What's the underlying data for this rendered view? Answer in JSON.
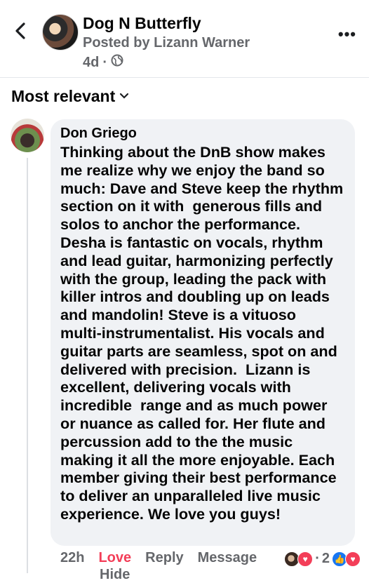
{
  "header": {
    "page_name": "Dog N Butterfly",
    "posted_by": "Posted by Lizann Warner",
    "time": "4d",
    "separator": "·",
    "privacy_icon": "globe-icon",
    "back_icon": "chevron-left-icon",
    "more_icon": "more-dots-icon",
    "more_label": "•••"
  },
  "filter": {
    "label": "Most relevant",
    "icon": "chevron-down-icon"
  },
  "comment": {
    "author": "Don Griego",
    "text": "Thinking about the DnB show makes me realize why we enjoy the band so much: Dave and Steve keep the rhythm section on it with  generous fills and solos to anchor the performance. Desha is fantastic on vocals, rhythm and lead guitar, harmonizing perfectly with the group, leading the pack with killer intros and doubling up on leads and mandolin! Steve is a vituoso  multi-instrumentalist. His vocals and guitar parts are seamless, spot on and delivered with precision.  Lizann is excellent, delivering vocals with incredible  range and as much power or nuance as called for. Her flute and percussion add to the the music making it all the more enjoyable. Each member giving their best performance to deliver an unparalleled live music experience. We love you guys!",
    "time": "22h",
    "love_label": "Love",
    "reply_label": "Reply",
    "message_label": "Message",
    "reaction_count_a": "2",
    "reaction_separator": "·",
    "cut_off_label": "Hide"
  },
  "colors": {
    "love": "#f33e58",
    "like": "#1877f2",
    "meta": "#65676b",
    "bubble": "#f0f2f5"
  }
}
